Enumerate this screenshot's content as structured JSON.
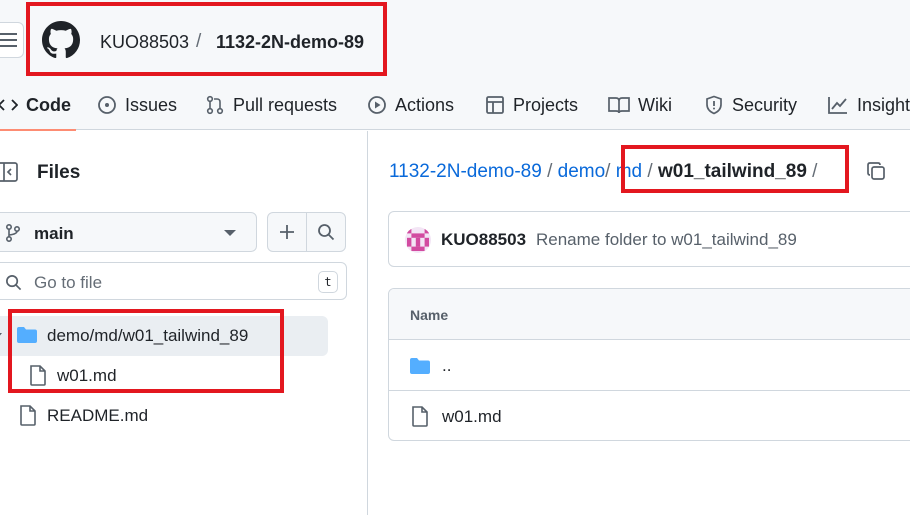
{
  "header": {
    "owner": "KUO88503",
    "separator": "/",
    "repo": "1132-2N-demo-89"
  },
  "tabs": [
    {
      "label": "Code",
      "icon": "code-icon",
      "active": true
    },
    {
      "label": "Issues",
      "icon": "issue-icon"
    },
    {
      "label": "Pull requests",
      "icon": "pull-request-icon"
    },
    {
      "label": "Actions",
      "icon": "play-icon"
    },
    {
      "label": "Projects",
      "icon": "table-icon"
    },
    {
      "label": "Wiki",
      "icon": "book-icon"
    },
    {
      "label": "Security",
      "icon": "shield-icon"
    },
    {
      "label": "Insights",
      "icon": "graph-icon"
    }
  ],
  "sidebar": {
    "title": "Files",
    "branch": "main",
    "goto_placeholder": "Go to file",
    "goto_shortcut": "t",
    "tree": [
      {
        "label": "demo/md/w01_tailwind_89",
        "type": "folder",
        "selected": true
      },
      {
        "label": "w01.md",
        "type": "file"
      },
      {
        "label": "README.md",
        "type": "file"
      }
    ]
  },
  "breadcrumb": {
    "root": "1132-2N-demo-89",
    "seg1": "demo",
    "seg2": "md",
    "current": "w01_tailwind_89",
    "separator": "/"
  },
  "commit": {
    "author": "KUO88503",
    "message": "Rename folder to w01_tailwind_89"
  },
  "table": {
    "header": "Name",
    "rows": [
      {
        "label": "..",
        "type": "folder"
      },
      {
        "label": "w01.md",
        "type": "file"
      }
    ]
  },
  "colors": {
    "link": "#0969da",
    "highlight": "#e3171f",
    "folder": "#54aeff",
    "tab_underline": "#fd8c73"
  }
}
